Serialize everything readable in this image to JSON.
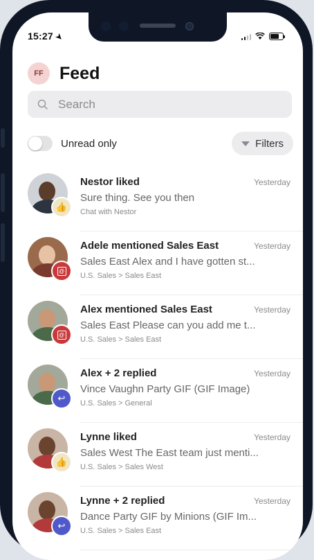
{
  "status_bar": {
    "time": "15:27"
  },
  "header": {
    "avatar_initials": "FF",
    "title": "Feed"
  },
  "search": {
    "placeholder": "Search"
  },
  "filters": {
    "toggle_label": "Unread only",
    "filters_label": "Filters"
  },
  "feed": [
    {
      "title": "Nestor liked",
      "time": "Yesterday",
      "preview": "Sure thing. See you then",
      "context": "Chat with Nestor",
      "badge": "like-icon",
      "avatar": {
        "skin": "#5a3d2b",
        "shirt": "#2d3440",
        "bg": "#cfd3d8"
      }
    },
    {
      "title": "Adele mentioned Sales East",
      "time": "Yesterday",
      "preview": "Sales East Alex and I have gotten st...",
      "context": "U.S. Sales > Sales East",
      "badge": "mention-icon",
      "avatar": {
        "skin": "#e8c2a5",
        "shirt": "#7a3b2e",
        "bg": "#9a6a4c"
      }
    },
    {
      "title": "Alex mentioned Sales East",
      "time": "Yesterday",
      "preview": "Sales East Please can you add me t...",
      "context": "U.S. Sales > Sales East",
      "badge": "mention-icon",
      "avatar": {
        "skin": "#c99877",
        "shirt": "#4a6a4a",
        "bg": "#a2a89a"
      }
    },
    {
      "title": "Alex + 2 replied",
      "time": "Yesterday",
      "preview": "Vince Vaughn Party GIF (GIF Image)",
      "context": "U.S. Sales > General",
      "badge": "reply-icon",
      "avatar": {
        "skin": "#c99877",
        "shirt": "#4a6a4a",
        "bg": "#a2a89a"
      }
    },
    {
      "title": "Lynne liked",
      "time": "Yesterday",
      "preview": "Sales West The East team just menti...",
      "context": "U.S. Sales > Sales West",
      "badge": "like-icon",
      "avatar": {
        "skin": "#6b4430",
        "shirt": "#b23a3a",
        "bg": "#c8b5a5"
      }
    },
    {
      "title": "Lynne + 2 replied",
      "time": "Yesterday",
      "preview": "Dance Party GIF by Minions (GIF Im...",
      "context": "U.S. Sales > Sales East",
      "badge": "reply-icon",
      "avatar": {
        "skin": "#6b4430",
        "shirt": "#b23a3a",
        "bg": "#c8b5a5"
      }
    }
  ],
  "colors": {
    "like_badge": "#f1e6c3",
    "mention_badge": "#c9393b",
    "reply_badge": "#5059c9"
  }
}
